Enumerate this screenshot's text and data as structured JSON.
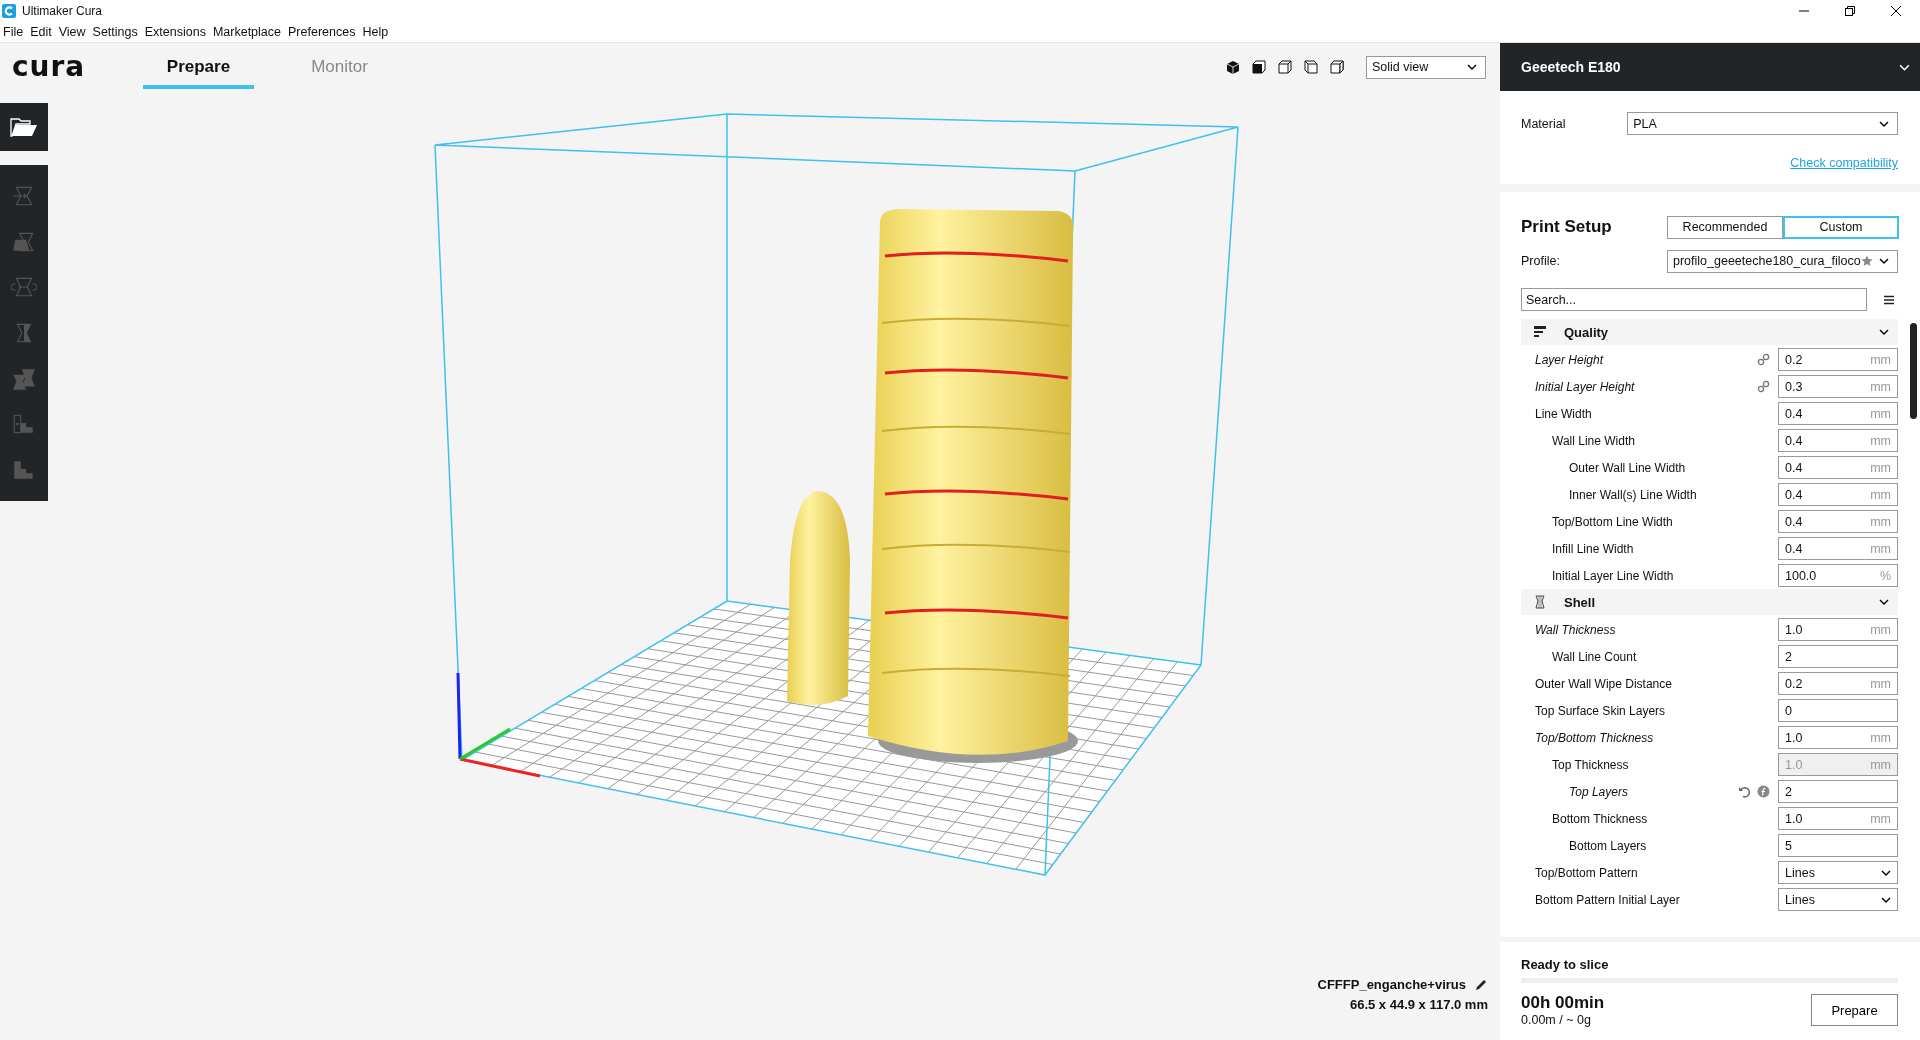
{
  "window": {
    "title": "Ultimaker Cura"
  },
  "menu": [
    "File",
    "Edit",
    "View",
    "Settings",
    "Extensions",
    "Marketplace",
    "Preferences",
    "Help"
  ],
  "logo": "cura",
  "tabs": [
    {
      "label": "Prepare",
      "selected": true
    },
    {
      "label": "Monitor",
      "selected": false
    }
  ],
  "view_mode": {
    "value": "Solid view"
  },
  "model": {
    "name": "CFFFP_enganche+virus",
    "dimensions": "66.5 x 44.9 x 117.0 mm"
  },
  "printer": {
    "name": "Geeetech E180"
  },
  "material": {
    "label": "Material",
    "value": "PLA",
    "link": "Check compatibility"
  },
  "print_setup": {
    "title": "Print Setup",
    "modes": [
      {
        "label": "Recommended",
        "selected": false
      },
      {
        "label": "Custom",
        "selected": true
      }
    ],
    "profile": {
      "label": "Profile:",
      "value": "profilo_geeeteche180_cura_filoco"
    },
    "search": {
      "placeholder": "Search..."
    }
  },
  "categories": [
    {
      "name": "Quality",
      "kind": "quality",
      "settings": [
        {
          "label": "Layer Height",
          "kind": "number",
          "value": "0.2",
          "unit": "mm",
          "modified": true,
          "disabled": false,
          "indicators": [
            {
              "kind": "link"
            }
          ]
        },
        {
          "label": "Initial Layer Height",
          "kind": "number",
          "value": "0.3",
          "unit": "mm",
          "modified": true,
          "disabled": false,
          "indicators": [
            {
              "kind": "link"
            }
          ]
        },
        {
          "label": "Line Width",
          "kind": "number",
          "value": "0.4",
          "unit": "mm",
          "modified": false,
          "disabled": false,
          "children": [
            {
              "label": "Wall Line Width",
              "kind": "number",
              "value": "0.4",
              "unit": "mm",
              "modified": false,
              "disabled": false,
              "children": [
                {
                  "label": "Outer Wall Line Width",
                  "kind": "number",
                  "value": "0.4",
                  "unit": "mm",
                  "modified": false,
                  "disabled": false
                },
                {
                  "label": "Inner Wall(s) Line Width",
                  "kind": "number",
                  "value": "0.4",
                  "unit": "mm",
                  "modified": false,
                  "disabled": false
                }
              ]
            },
            {
              "label": "Top/Bottom Line Width",
              "kind": "number",
              "value": "0.4",
              "unit": "mm",
              "modified": false,
              "disabled": false
            },
            {
              "label": "Infill Line Width",
              "kind": "number",
              "value": "0.4",
              "unit": "mm",
              "modified": false,
              "disabled": false
            },
            {
              "label": "Initial Layer Line Width",
              "kind": "number",
              "value": "100.0",
              "unit": "%",
              "modified": false,
              "disabled": false
            }
          ]
        }
      ]
    },
    {
      "name": "Shell",
      "kind": "shell",
      "settings": [
        {
          "label": "Wall Thickness",
          "kind": "number",
          "value": "1.0",
          "unit": "mm",
          "modified": true,
          "disabled": false,
          "children": [
            {
              "label": "Wall Line Count",
              "kind": "number",
              "value": "2",
              "modified": false,
              "disabled": false
            }
          ]
        },
        {
          "label": "Outer Wall Wipe Distance",
          "kind": "number",
          "value": "0.2",
          "unit": "mm",
          "modified": false,
          "disabled": false
        },
        {
          "label": "Top Surface Skin Layers",
          "kind": "number",
          "value": "0",
          "modified": false,
          "disabled": false
        },
        {
          "label": "Top/Bottom Thickness",
          "kind": "number",
          "value": "1.0",
          "unit": "mm",
          "modified": true,
          "disabled": false,
          "children": [
            {
              "label": "Top Thickness",
              "kind": "number",
              "value": "1.0",
              "unit": "mm",
              "modified": false,
              "disabled": true,
              "children": [
                {
                  "label": "Top Layers",
                  "kind": "number",
                  "value": "2",
                  "modified": true,
                  "disabled": false,
                  "indicators": [
                    {
                      "kind": "reset"
                    },
                    {
                      "kind": "function"
                    }
                  ]
                }
              ]
            },
            {
              "label": "Bottom Thickness",
              "kind": "number",
              "value": "1.0",
              "unit": "mm",
              "modified": false,
              "disabled": false,
              "children": [
                {
                  "label": "Bottom Layers",
                  "kind": "number",
                  "value": "5",
                  "modified": false,
                  "disabled": false
                }
              ]
            }
          ]
        },
        {
          "label": "Top/Bottom Pattern",
          "kind": "dropdown",
          "value": "Lines",
          "modified": false,
          "disabled": false
        },
        {
          "label": "Bottom Pattern Initial Layer",
          "kind": "dropdown",
          "value": "Lines",
          "modified": false,
          "disabled": false
        }
      ]
    }
  ],
  "slice": {
    "status": "Ready to slice",
    "time": "00h 00min",
    "usage": "0.00m / ~ 0g",
    "button": "Prepare"
  }
}
